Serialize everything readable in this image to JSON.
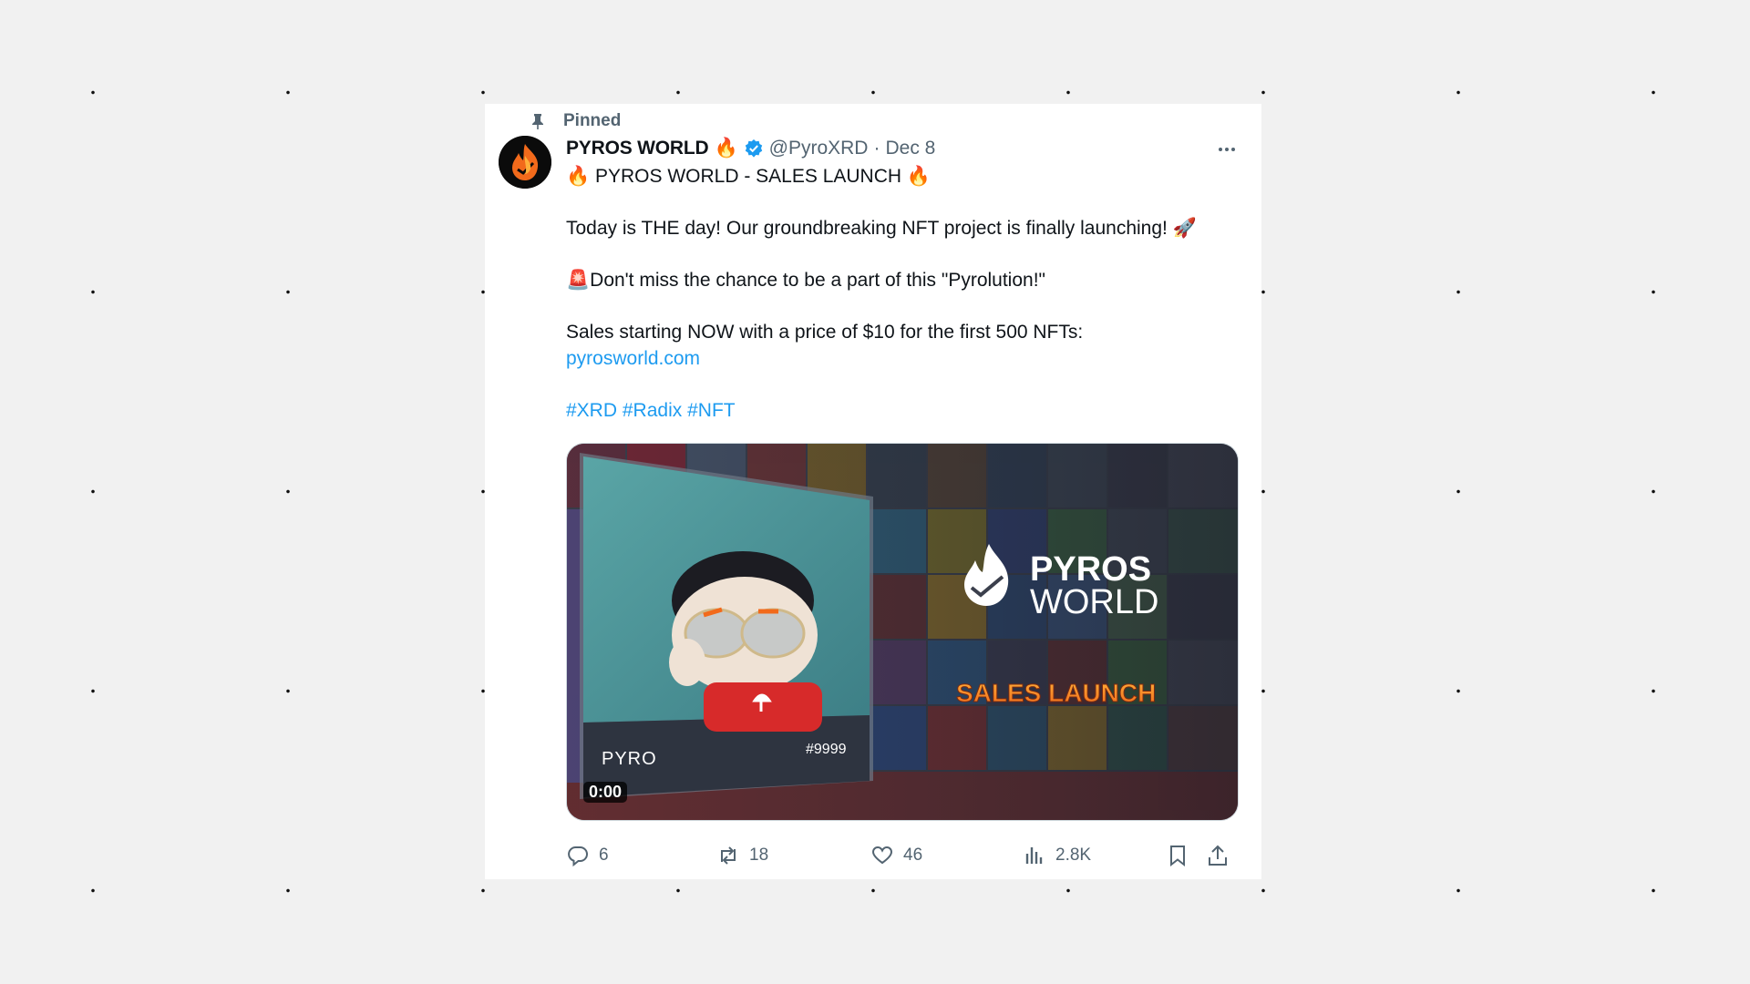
{
  "tweet": {
    "pinned_label": "Pinned",
    "author_name": "PYROS WORLD",
    "author_emoji": "🔥",
    "handle": "@PyroXRD",
    "separator": "·",
    "date": "Dec 8",
    "lines": [
      "🔥  PYROS WORLD - SALES LAUNCH 🔥",
      "",
      "Today is THE day! Our groundbreaking NFT project is finally launching! 🚀",
      "",
      "🚨Don't miss the chance to be a part of this \"Pyrolution!\"",
      "",
      "Sales starting NOW with a price of $10 for the first 500 NFTs:"
    ],
    "link": "pyrosworld.com",
    "hashtags": [
      "#XRD",
      "#Radix",
      "#NFT"
    ]
  },
  "media": {
    "timecode": "0:00",
    "nft_name": "PYRO",
    "nft_number": "#9999",
    "brand_line1": "PYROS",
    "brand_line2": "WORLD",
    "headline": "SALES LAUNCH"
  },
  "actions": {
    "replies": "6",
    "reposts": "18",
    "likes": "46",
    "views": "2.8K"
  },
  "colors": {
    "link": "#1d9bf0",
    "secondary_text": "#536471",
    "verified": "#1d9bf0",
    "flame": "#f26a1b"
  }
}
